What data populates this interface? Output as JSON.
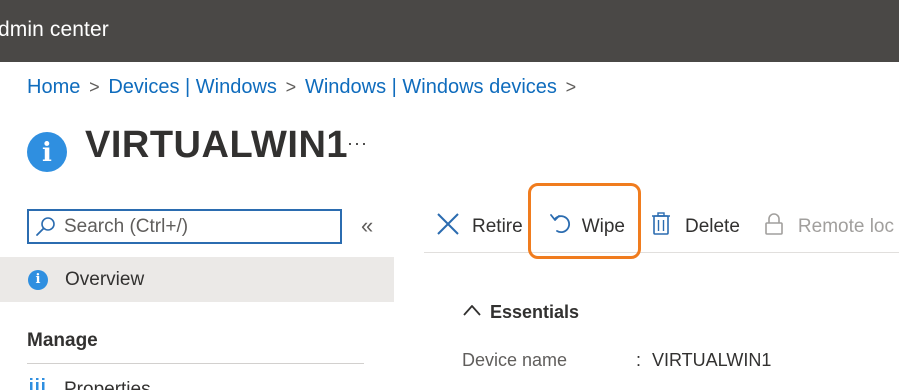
{
  "header": {
    "title": "dmin center"
  },
  "breadcrumb": {
    "items": [
      "Home",
      "Devices | Windows",
      "Windows | Windows devices"
    ],
    "separator": ">"
  },
  "page": {
    "title": "VIRTUALWIN1",
    "more_label": "···"
  },
  "sidebar": {
    "search_placeholder": "Search (Ctrl+/)",
    "collapse_label": "«",
    "overview_label": "Overview",
    "manage_heading": "Manage",
    "properties_label": "Properties"
  },
  "toolbar": {
    "retire_label": "Retire",
    "wipe_label": "Wipe",
    "delete_label": "Delete",
    "remote_lock_label": "Remote loc"
  },
  "essentials": {
    "heading": "Essentials",
    "fields": [
      {
        "label": "Device name",
        "separator": ":",
        "value": "VIRTUALWIN1"
      }
    ]
  },
  "colors": {
    "topbar": "#4a4846",
    "link": "#0f6cbd",
    "info_icon": "#2f8fe0",
    "highlight": "#f07c1e",
    "selected_nav": "#ebe9e7"
  }
}
